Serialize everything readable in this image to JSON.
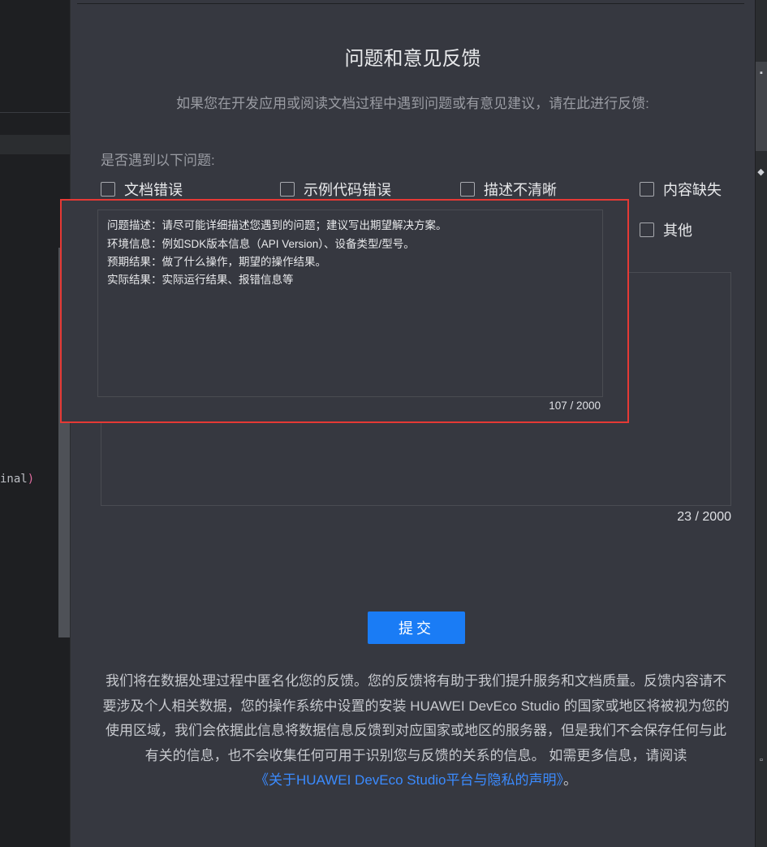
{
  "editor": {
    "code_text": "inal",
    "code_paren": ")"
  },
  "feedback": {
    "title": "问题和意见反馈",
    "subtitle": "如果您在开发应用或阅读文档过程中遇到问题或有意见建议，请在此进行反馈:",
    "question": "是否遇到以下问题:",
    "options": [
      {
        "label": "文档错误",
        "checked": false
      },
      {
        "label": "示例代码错误",
        "checked": false
      },
      {
        "label": "描述不清晰",
        "checked": false
      },
      {
        "label": "内容缺失",
        "checked": false
      },
      {
        "label": "其他",
        "checked": false
      }
    ],
    "background_textarea_count": "23 / 2000",
    "overlay_textarea": {
      "lines": [
        "问题描述：请尽可能详细描述您遇到的问题；建议写出期望解决方案。",
        "环境信息：例如SDK版本信息（API Version）、设备类型/型号。",
        "预期结果：做了什么操作，期望的操作结果。",
        "实际结果：实际运行结果、报错信息等"
      ],
      "count": "107 / 2000"
    },
    "submit_label": "提交",
    "notice_text": "我们将在数据处理过程中匿名化您的反馈。您的反馈将有助于我们提升服务和文档质量。反馈内容请不要涉及个人相关数据，您的操作系统中设置的安装 HUAWEI DevEco Studio 的国家或地区将被视为您的使用区域，我们会依据此信息将数据信息反馈到对应国家或地区的服务器，但是我们不会保存任何与此有关的信息，也不会收集任何可用于识别您与反馈的关系的信息。 如需更多信息，请阅读",
    "notice_link": "《关于HUAWEI DevEco Studio平台与隐私的声明》",
    "notice_end": "。"
  },
  "colors": {
    "accent": "#1a7cf5",
    "highlight_border": "#e53935",
    "link": "#3b8bff"
  }
}
